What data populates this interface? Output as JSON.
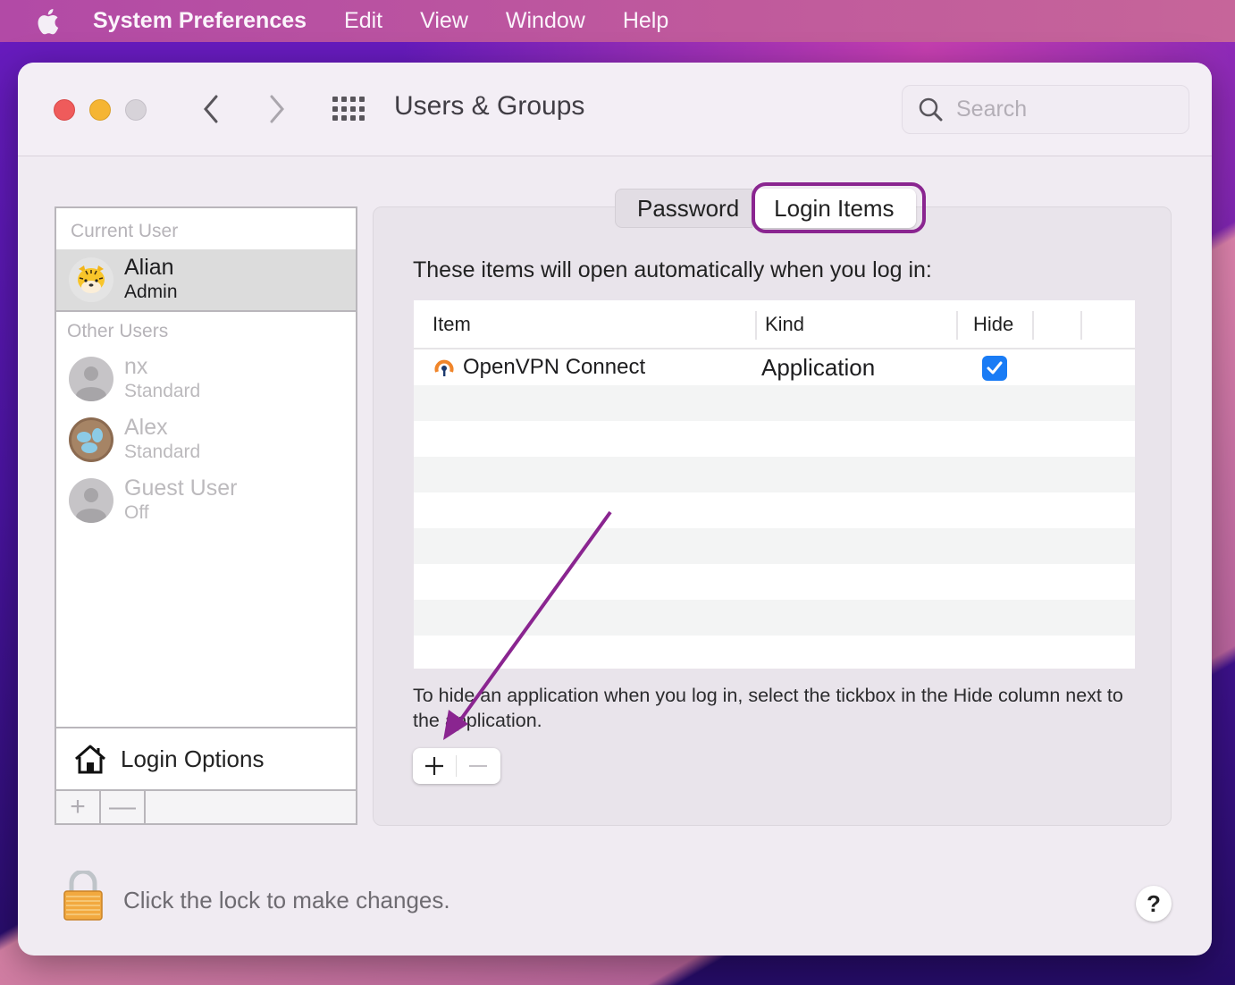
{
  "menubar": {
    "apple_icon": "apple-logo-icon",
    "app_name": "System Preferences",
    "items": [
      "Edit",
      "View",
      "Window",
      "Help"
    ]
  },
  "window": {
    "title": "Users & Groups",
    "search_placeholder": "Search",
    "search_value": ""
  },
  "sidebar": {
    "current_user_label": "Current User",
    "current_user": {
      "name": "Alian",
      "role": "Admin",
      "avatar": "tiger-avatar"
    },
    "other_users_label": "Other Users",
    "other_users": [
      {
        "name": "nx",
        "role": "Standard",
        "avatar": "generic-person-avatar"
      },
      {
        "name": "Alex",
        "role": "Standard",
        "avatar": "bird-nest-eggs-avatar"
      },
      {
        "name": "Guest User",
        "role": "Off",
        "avatar": "generic-person-avatar"
      }
    ],
    "login_options_label": "Login Options",
    "add_label": "+",
    "remove_label": "—"
  },
  "tabs": [
    {
      "label": "Password",
      "active": false
    },
    {
      "label": "Login Items",
      "active": true
    }
  ],
  "login_items": {
    "intro": "These items will open automatically when you log in:",
    "columns": [
      "Item",
      "Kind",
      "Hide"
    ],
    "rows": [
      {
        "item": "OpenVPN Connect",
        "kind": "Application",
        "hide": true,
        "icon": "openvpn-icon"
      }
    ],
    "hint": "To hide an application when you log in, select the tickbox in the Hide column next to the application.",
    "add_label": "+",
    "remove_label": "—"
  },
  "footer": {
    "lock_text": "Click the lock to make changes.",
    "help_label": "?"
  },
  "colors": {
    "annotation": "#8a2590",
    "checkbox": "#1a7cf5",
    "close": "#ef5b5b",
    "minimize": "#f5b533"
  }
}
